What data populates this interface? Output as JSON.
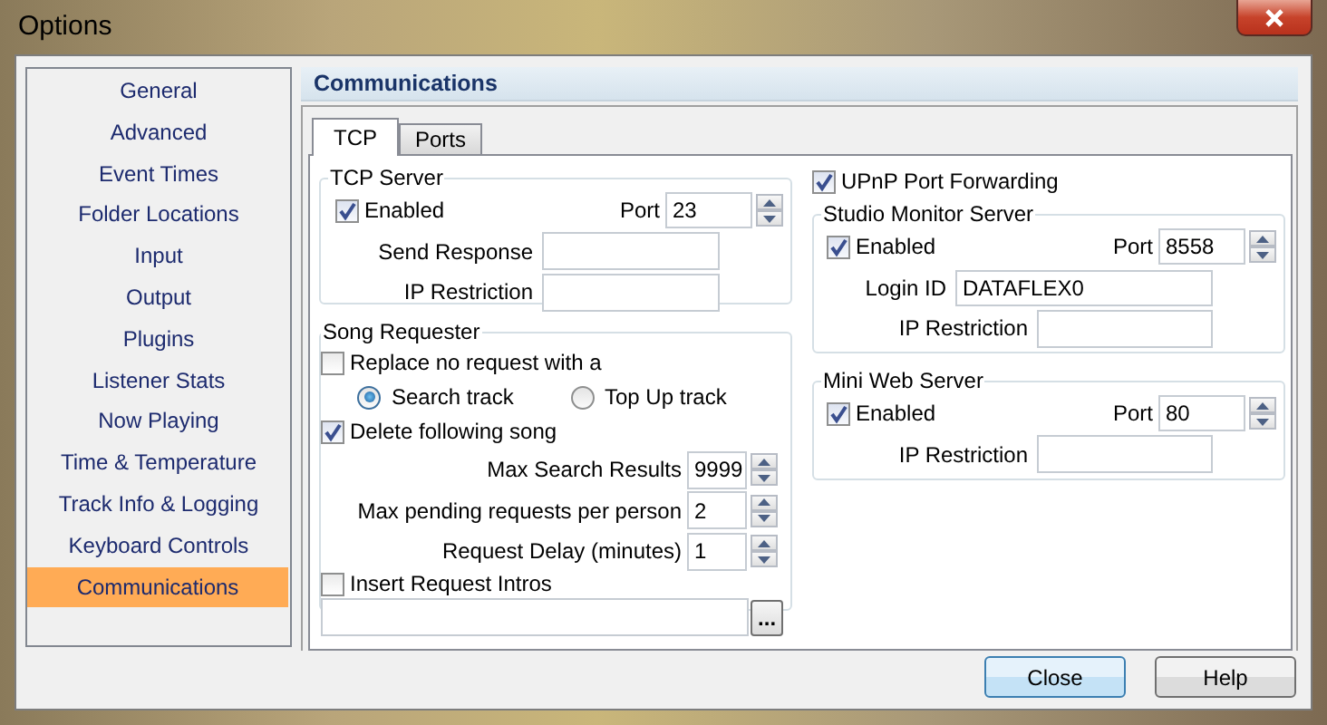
{
  "window": {
    "title": "Options"
  },
  "sidebar": {
    "items": [
      {
        "label": "General",
        "selected": false
      },
      {
        "label": "Advanced",
        "selected": false
      },
      {
        "label": "Event Times",
        "selected": false
      },
      {
        "label": "Folder Locations",
        "selected": false
      },
      {
        "label": "Input",
        "selected": false
      },
      {
        "label": "Output",
        "selected": false
      },
      {
        "label": "Plugins",
        "selected": false
      },
      {
        "label": "Listener Stats",
        "selected": false
      },
      {
        "label": "Now Playing",
        "selected": false
      },
      {
        "label": "Time & Temperature",
        "selected": false
      },
      {
        "label": "Track Info & Logging",
        "selected": false
      },
      {
        "label": "Keyboard Controls",
        "selected": false
      },
      {
        "label": "Communications",
        "selected": true
      }
    ]
  },
  "panel": {
    "title": "Communications"
  },
  "tabs": [
    {
      "label": "TCP",
      "selected": true
    },
    {
      "label": "Ports",
      "selected": false
    }
  ],
  "tcp_server": {
    "title": "TCP Server",
    "enabled": {
      "label": "Enabled",
      "checked": true
    },
    "port": {
      "label": "Port",
      "value": "23"
    },
    "send_response": {
      "label": "Send Response"
    },
    "ip_restriction": {
      "label": "IP Restriction"
    }
  },
  "song_requester": {
    "title": "Song Requester",
    "replace": {
      "label": "Replace no request with a",
      "checked": false
    },
    "radios": [
      {
        "label": "Search track",
        "selected": true
      },
      {
        "label": "Top Up track",
        "selected": false
      }
    ],
    "delete_following": {
      "label": "Delete following song",
      "checked": true
    },
    "spinners": [
      {
        "label": "Max Search Results",
        "value": "9999"
      },
      {
        "label": "Max pending requests per person",
        "value": "2"
      },
      {
        "label": "Request Delay (minutes)",
        "value": "1"
      }
    ],
    "insert_intros": {
      "label": "Insert Request Intros",
      "checked": false
    },
    "browse_button": "..."
  },
  "upnp": {
    "label": "UPnP Port Forwarding",
    "checked": true
  },
  "studio_monitor": {
    "title": "Studio Monitor Server",
    "enabled": {
      "label": "Enabled",
      "checked": true
    },
    "port": {
      "label": "Port",
      "value": "8558"
    },
    "login_id": {
      "label": "Login ID",
      "value": "DATAFLEX0"
    },
    "ip_restriction": {
      "label": "IP Restriction"
    }
  },
  "mini_web": {
    "title": "Mini Web Server",
    "enabled": {
      "label": "Enabled",
      "checked": true
    },
    "port": {
      "label": "Port",
      "value": "80"
    },
    "ip_restriction": {
      "label": "IP Restriction"
    }
  },
  "buttons": [
    {
      "label": "Close",
      "kind": "default"
    },
    {
      "label": "Help",
      "kind": "normal"
    }
  ]
}
